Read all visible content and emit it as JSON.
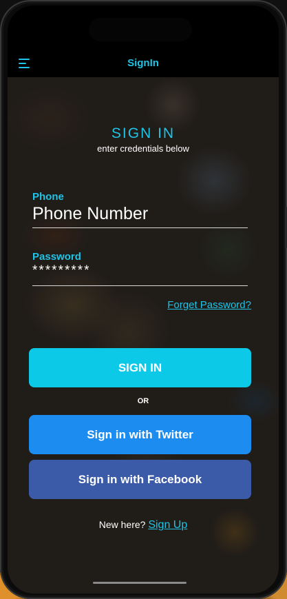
{
  "nav": {
    "title": "SignIn",
    "menu_icon": "hamburger-menu-icon"
  },
  "header": {
    "title": "SIGN IN",
    "subtitle": "enter credentials below"
  },
  "form": {
    "phone_label": "Phone",
    "phone_value": "Phone Number",
    "password_label": "Password",
    "password_value": "*********",
    "forgot_link": "Forget Password?"
  },
  "buttons": {
    "signin": "SIGN IN",
    "or": "OR",
    "twitter": "Sign in with Twitter",
    "facebook": "Sign in with Facebook"
  },
  "footer": {
    "prompt": "New here?",
    "signup_link": "Sign Up"
  },
  "colors": {
    "accent": "#20c3e6",
    "signin_button": "#0cc9e8",
    "twitter_button": "#1d8cf0",
    "facebook_button": "#3b5ba8"
  }
}
